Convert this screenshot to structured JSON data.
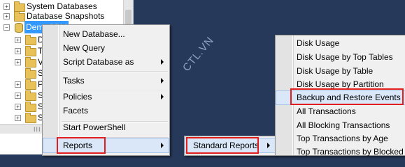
{
  "explorer": {
    "nodes": [
      {
        "label": "System Databases",
        "expander": "+",
        "icon": "folder-icon"
      },
      {
        "label": "Database Snapshots",
        "expander": "+",
        "icon": "folder-icon"
      },
      {
        "label": "DemoCRM",
        "expander": "−",
        "icon": "database-icon"
      },
      {
        "label": "D",
        "expander": "+",
        "icon": "folder-icon"
      },
      {
        "label": "T",
        "expander": "+",
        "icon": "folder-icon"
      },
      {
        "label": "V",
        "expander": "+",
        "icon": "folder-icon"
      },
      {
        "label": "S",
        "expander": "",
        "icon": "folder-icon"
      },
      {
        "label": "P",
        "expander": "+",
        "icon": "folder-icon"
      },
      {
        "label": "S",
        "expander": "+",
        "icon": "folder-icon"
      },
      {
        "label": "S",
        "expander": "+",
        "icon": "folder-icon"
      },
      {
        "label": "S",
        "expander": "+",
        "icon": "folder-icon"
      }
    ],
    "scroll_grip": "III"
  },
  "watermark": "CTL.VN",
  "context_menu": {
    "items": [
      {
        "label": "New Database..."
      },
      {
        "label": "New Query"
      },
      {
        "label": "Script Database as",
        "submenu": true
      },
      {
        "label": "Tasks",
        "submenu": true
      },
      {
        "label": "Policies",
        "submenu": true
      },
      {
        "label": "Facets"
      },
      {
        "label": "Start PowerShell"
      },
      {
        "label": "Reports",
        "submenu": true
      }
    ]
  },
  "reports_menu": {
    "items": [
      {
        "label": "Standard Reports",
        "submenu": true
      }
    ]
  },
  "standard_reports_menu": {
    "items": [
      {
        "label": "Disk Usage"
      },
      {
        "label": "Disk Usage by Top Tables"
      },
      {
        "label": "Disk Usage by Table"
      },
      {
        "label": "Disk Usage by Partition"
      },
      {
        "label": "Backup and Restore Events"
      },
      {
        "label": "All Transactions"
      },
      {
        "label": "All Blocking Transactions"
      },
      {
        "label": "Top Transactions by Age"
      },
      {
        "label": "Top Transactions by Blocked Tran"
      }
    ]
  },
  "highlight_color": "#e31c1c",
  "selection_color": "#3399ff"
}
